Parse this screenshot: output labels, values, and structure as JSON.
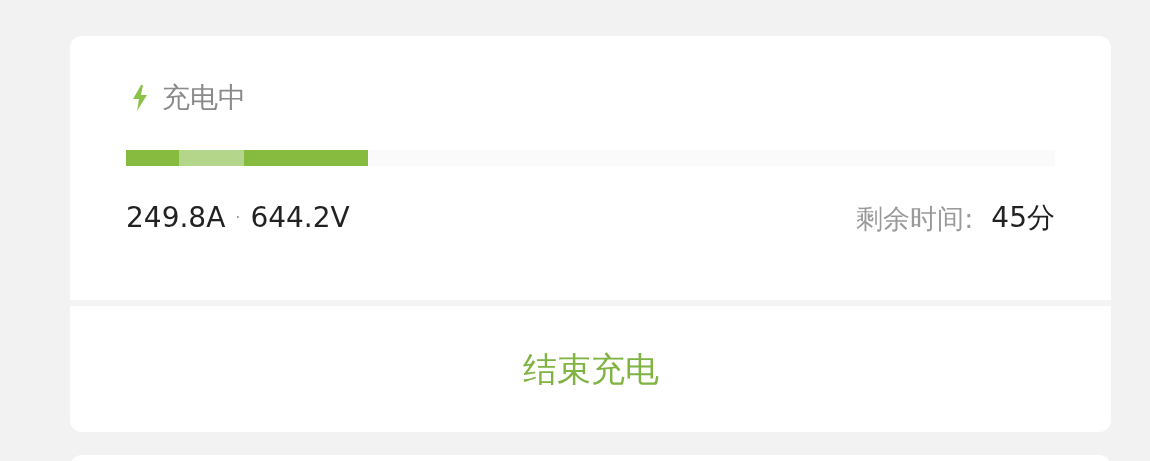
{
  "status": {
    "label": "充电中"
  },
  "progress": {
    "level": 0.26
  },
  "readings": {
    "current": "249.8A",
    "separator": "·",
    "voltage": "644.2V"
  },
  "remaining": {
    "label": "剩余时间:",
    "value": "45分"
  },
  "action": {
    "label": "结束充电"
  }
}
